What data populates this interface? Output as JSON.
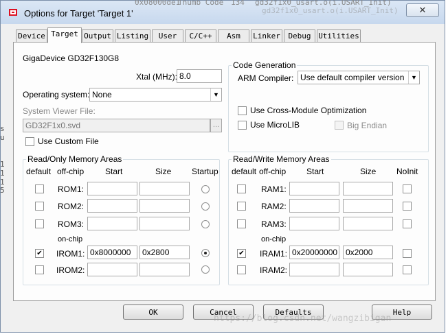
{
  "window": {
    "title": "Options for Target 'Target 1'",
    "close_label": "✕",
    "bg_text": [
      "0x08000de1",
      "Thumb Code",
      "134",
      "gd32f1x0_usart.o(i.USART_Init)"
    ]
  },
  "tabs": [
    "Device",
    "Target",
    "Output",
    "Listing",
    "User",
    "C/C++",
    "Asm",
    "Linker",
    "Debug",
    "Utilities"
  ],
  "active_tab": "Target",
  "device_name": "GigaDevice GD32F130G8",
  "xtal": {
    "label": "Xtal (MHz):",
    "value": "8.0"
  },
  "os": {
    "label": "Operating system:",
    "value": "None"
  },
  "svd": {
    "label": "System Viewer File:",
    "value": "GD32F1x0.svd",
    "browse": "..."
  },
  "custom_file": {
    "label": "Use Custom File",
    "checked": false
  },
  "code_gen": {
    "title": "Code Generation",
    "compiler_label": "ARM Compiler:",
    "compiler_value": "Use default compiler version",
    "cross_module": {
      "label": "Use Cross-Module Optimization",
      "checked": false
    },
    "microlib": {
      "label": "Use MicroLIB",
      "checked": false
    },
    "big_endian": {
      "label": "Big Endian",
      "checked": false
    }
  },
  "ro_memory": {
    "title": "Read/Only Memory Areas",
    "headers": {
      "default": "default",
      "offchip": "off-chip",
      "start": "Start",
      "size": "Size",
      "startup": "Startup"
    },
    "onchip_label": "on-chip",
    "rows": [
      {
        "name": "ROM1:",
        "default": false,
        "start": "",
        "size": "",
        "startup": false
      },
      {
        "name": "ROM2:",
        "default": false,
        "start": "",
        "size": "",
        "startup": false
      },
      {
        "name": "ROM3:",
        "default": false,
        "start": "",
        "size": "",
        "startup": false
      },
      {
        "name": "IROM1:",
        "default": true,
        "start": "0x8000000",
        "size": "0x2800",
        "startup": true
      },
      {
        "name": "IROM2:",
        "default": false,
        "start": "",
        "size": "",
        "startup": false
      }
    ]
  },
  "rw_memory": {
    "title": "Read/Write Memory Areas",
    "headers": {
      "default": "default",
      "offchip": "off-chip",
      "start": "Start",
      "size": "Size",
      "noinit": "NoInit"
    },
    "onchip_label": "on-chip",
    "rows": [
      {
        "name": "RAM1:",
        "default": false,
        "start": "",
        "size": "",
        "noinit": false
      },
      {
        "name": "RAM2:",
        "default": false,
        "start": "",
        "size": "",
        "noinit": false
      },
      {
        "name": "RAM3:",
        "default": false,
        "start": "",
        "size": "",
        "noinit": false
      },
      {
        "name": "IRAM1:",
        "default": true,
        "start": "0x20000000",
        "size": "0x2000",
        "noinit": false
      },
      {
        "name": "IRAM2:",
        "default": false,
        "start": "",
        "size": "",
        "noinit": false
      }
    ]
  },
  "buttons": {
    "ok": "OK",
    "cancel": "Cancel",
    "defaults": "Defaults",
    "help": "Help"
  },
  "watermark": "https://blog.csdn.net/wangzibigan",
  "side_fragments": [
    "s",
    "u",
    "1",
    "1",
    "1",
    "5"
  ]
}
